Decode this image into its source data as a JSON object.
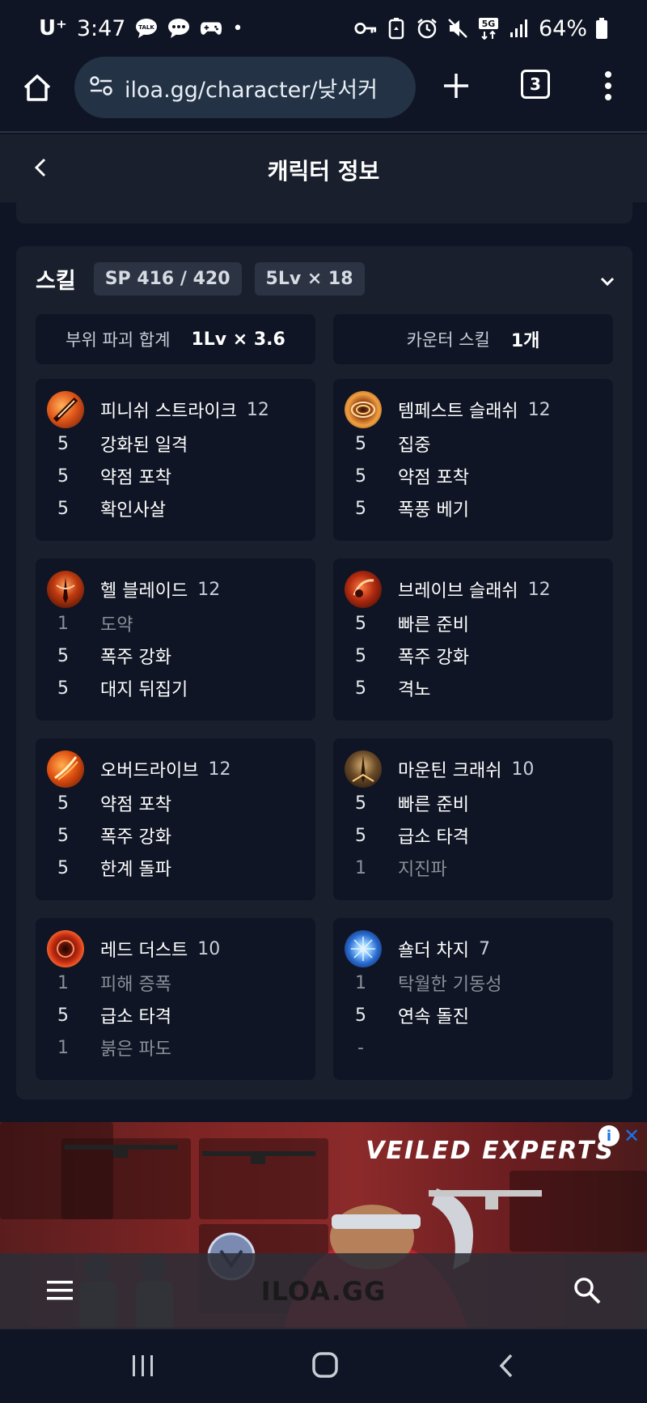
{
  "status_bar": {
    "carrier": "U⁺",
    "time": "3:47",
    "dot": "•",
    "battery": "64%",
    "icons": [
      "talk-icon",
      "message-icon",
      "game-controller-icon",
      "key-icon",
      "battery-saver-icon",
      "alarm-icon",
      "mute-icon",
      "5g-icon",
      "signal-icon",
      "battery-icon"
    ]
  },
  "browser": {
    "url": "iloa.gg/character/낮서커",
    "tab_count": "3"
  },
  "header": {
    "title": "캐릭터 정보"
  },
  "skills": {
    "title": "스킬",
    "sp": "SP 416 / 420",
    "level_count": "5Lv × 18",
    "summary": [
      {
        "label": "부위 파괴 합계",
        "value": "1Lv × 3.6"
      },
      {
        "label": "카운터 스킬",
        "value": "1개"
      }
    ],
    "list": [
      {
        "name": "피니쉬 스트라이크",
        "level": "12",
        "tripods": [
          {
            "level": "5",
            "name": "강화된 일격"
          },
          {
            "level": "5",
            "name": "약점 포착"
          },
          {
            "level": "5",
            "name": "확인사살"
          }
        ]
      },
      {
        "name": "템페스트 슬래쉬",
        "level": "12",
        "tripods": [
          {
            "level": "5",
            "name": "집중"
          },
          {
            "level": "5",
            "name": "약점 포착"
          },
          {
            "level": "5",
            "name": "폭풍 베기"
          }
        ]
      },
      {
        "name": "헬 블레이드",
        "level": "12",
        "tripods": [
          {
            "level": "1",
            "name": "도약"
          },
          {
            "level": "5",
            "name": "폭주 강화"
          },
          {
            "level": "5",
            "name": "대지 뒤집기"
          }
        ]
      },
      {
        "name": "브레이브 슬래쉬",
        "level": "12",
        "tripods": [
          {
            "level": "5",
            "name": "빠른 준비"
          },
          {
            "level": "5",
            "name": "폭주 강화"
          },
          {
            "level": "5",
            "name": "격노"
          }
        ]
      },
      {
        "name": "오버드라이브",
        "level": "12",
        "tripods": [
          {
            "level": "5",
            "name": "약점 포착"
          },
          {
            "level": "5",
            "name": "폭주 강화"
          },
          {
            "level": "5",
            "name": "한계 돌파"
          }
        ]
      },
      {
        "name": "마운틴 크래쉬",
        "level": "10",
        "tripods": [
          {
            "level": "5",
            "name": "빠른 준비"
          },
          {
            "level": "5",
            "name": "급소 타격"
          },
          {
            "level": "1",
            "name": "지진파"
          }
        ]
      },
      {
        "name": "레드 더스트",
        "level": "10",
        "tripods": [
          {
            "level": "1",
            "name": "피해 증폭"
          },
          {
            "level": "5",
            "name": "급소 타격"
          },
          {
            "level": "1",
            "name": "붉은 파도"
          }
        ]
      },
      {
        "name": "숄더 차지",
        "level": "7",
        "tripods": [
          {
            "level": "1",
            "name": "탁월한 기동성"
          },
          {
            "level": "5",
            "name": "연속 돌진"
          },
          {
            "level": "-",
            "name": ""
          }
        ]
      }
    ]
  },
  "ad": {
    "brand": "VEILED EXPERTS",
    "info": "i",
    "close": "✕"
  },
  "bottom_bar": {
    "logo": "ILOA.GG"
  }
}
